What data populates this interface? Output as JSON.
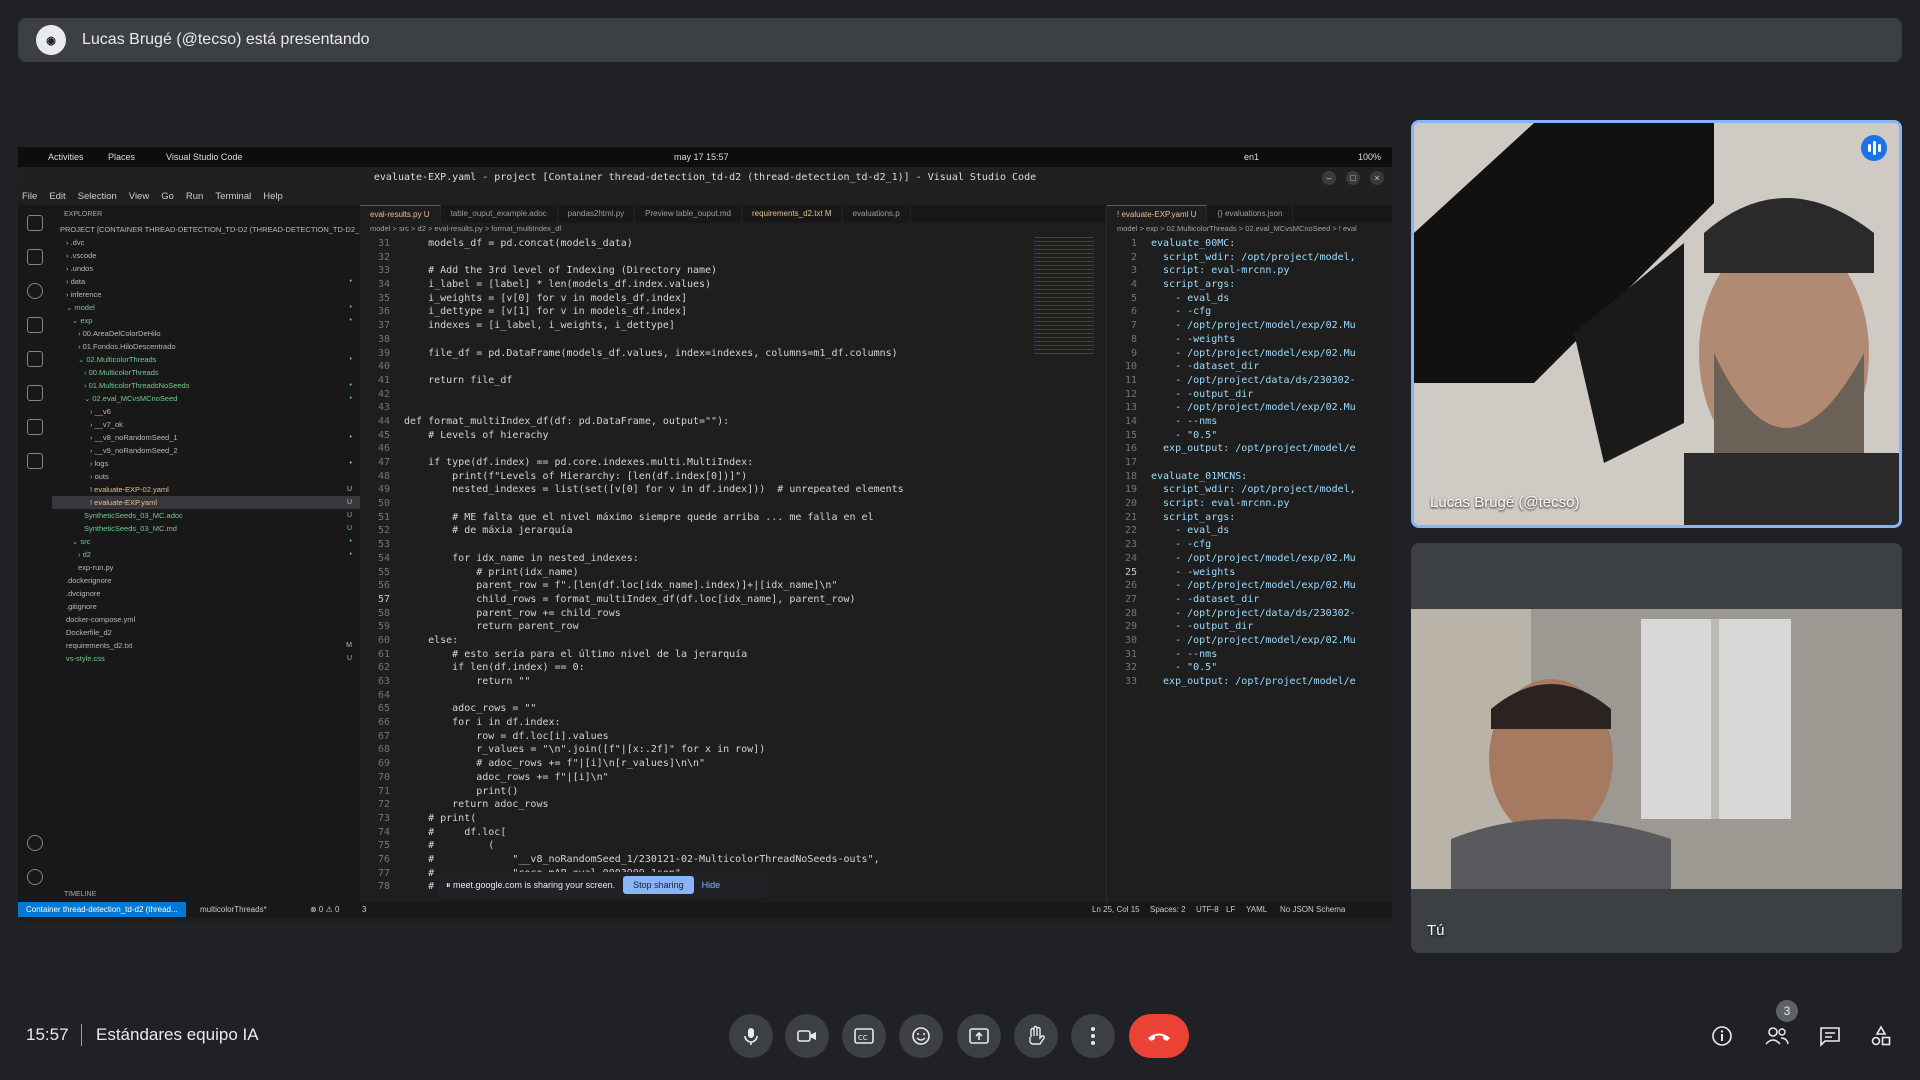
{
  "presenter_banner": {
    "text": "Lucas Brugé (@tecso) está presentando"
  },
  "shared_screen": {
    "gnome_bar": {
      "activities": "Activities",
      "places": "Places",
      "app": "Visual Studio Code",
      "clock": "may 17  15:57",
      "lang": "en1",
      "battery": "100%"
    },
    "window_title": "evaluate-EXP.yaml - project [Container thread-detection_td-d2 (thread-detection_td-d2_1)] - Visual Studio Code",
    "menu": [
      "File",
      "Edit",
      "Selection",
      "View",
      "Go",
      "Run",
      "Terminal",
      "Help"
    ],
    "explorer": {
      "header": "EXPLORER",
      "items": [
        {
          "label": "PROJECT [CONTAINER THREAD-DETECTION_TD-D2 (THREAD-DETECTION_TD-D2_1)]",
          "depth": 0,
          "color": "",
          "badge": ""
        },
        {
          "label": "› .dvc",
          "depth": 1,
          "color": "",
          "badge": ""
        },
        {
          "label": "› .vscode",
          "depth": 1,
          "color": "",
          "badge": ""
        },
        {
          "label": "› .undos",
          "depth": 1,
          "color": "",
          "badge": ""
        },
        {
          "label": "› data",
          "depth": 1,
          "color": "",
          "badge": "•"
        },
        {
          "label": "› inference",
          "depth": 1,
          "color": "",
          "badge": ""
        },
        {
          "label": "⌄ model",
          "depth": 1,
          "color": "green",
          "badge": "•"
        },
        {
          "label": "⌄ exp",
          "depth": 2,
          "color": "green",
          "badge": "•"
        },
        {
          "label": "› 00.AreaDelColorDeHilo",
          "depth": 3,
          "color": "",
          "badge": ""
        },
        {
          "label": "› 01.Fondos.HiloDescentrado",
          "depth": 3,
          "color": "",
          "badge": ""
        },
        {
          "label": "⌄ 02.MulticolorThreads",
          "depth": 3,
          "color": "green",
          "badge": "•"
        },
        {
          "label": "› 00.MulticolorThreads",
          "depth": 4,
          "color": "green",
          "badge": ""
        },
        {
          "label": "› 01.MulticolorThreadsNoSeeds",
          "depth": 4,
          "color": "green",
          "badge": "•"
        },
        {
          "label": "⌄ 02.eval_MCvsMCnoSeed",
          "depth": 4,
          "color": "green",
          "badge": "•"
        },
        {
          "label": "› __v6",
          "depth": 5,
          "color": "",
          "badge": ""
        },
        {
          "label": "› __v7_ok",
          "depth": 5,
          "color": "",
          "badge": ""
        },
        {
          "label": "› __v8_noRandomSeed_1",
          "depth": 5,
          "color": "",
          "badge": "•"
        },
        {
          "label": "› __v9_noRandomSeed_2",
          "depth": 5,
          "color": "",
          "badge": ""
        },
        {
          "label": "› logs",
          "depth": 5,
          "color": "",
          "badge": "•"
        },
        {
          "label": "› outs",
          "depth": 5,
          "color": "",
          "badge": ""
        },
        {
          "label": "! evaluate-EXP-02.yaml",
          "depth": 5,
          "color": "yellow",
          "badge": "U"
        },
        {
          "label": "! evaluate-EXP.yaml",
          "depth": 5,
          "color": "yellow",
          "badge": "U",
          "selected": true
        },
        {
          "label": "SyntheticSeeds_03_MC.adoc",
          "depth": 4,
          "color": "green",
          "badge": "U"
        },
        {
          "label": "SyntheticSeeds_03_MC.md",
          "depth": 4,
          "color": "green",
          "badge": "U"
        },
        {
          "label": "⌄ src",
          "depth": 2,
          "color": "green",
          "badge": "•"
        },
        {
          "label": "› d2",
          "depth": 3,
          "color": "green",
          "badge": "•"
        },
        {
          "label": "exp-run.py",
          "depth": 3,
          "color": "",
          "badge": ""
        },
        {
          "label": ".dockerignore",
          "depth": 1,
          "color": "",
          "badge": ""
        },
        {
          "label": ".dvcignore",
          "depth": 1,
          "color": "",
          "badge": ""
        },
        {
          "label": ".gitignore",
          "depth": 1,
          "color": "",
          "badge": ""
        },
        {
          "label": "docker-compose.yml",
          "depth": 1,
          "color": "",
          "badge": ""
        },
        {
          "label": "Dockerfile_d2",
          "depth": 1,
          "color": "",
          "badge": ""
        },
        {
          "label": "requirements_d2.txt",
          "depth": 1,
          "color": "",
          "badge": "M"
        },
        {
          "label": "vs-style.css",
          "depth": 1,
          "color": "green",
          "badge": "U"
        }
      ],
      "timeline": "TIMELINE"
    },
    "editor_left": {
      "tabs": [
        {
          "label": "eval-results.py U",
          "active": true,
          "mod": true
        },
        {
          "label": "table_ouput_example.adoc",
          "active": false,
          "mod": false
        },
        {
          "label": "pandas2html.py",
          "active": false,
          "mod": false
        },
        {
          "label": "Preview table_ouput.md",
          "active": false,
          "mod": false
        },
        {
          "label": "requirements_d2.txt M",
          "active": false,
          "mod": true
        },
        {
          "label": "evaluations.p",
          "active": false,
          "mod": false
        }
      ],
      "breadcrumb": "model > src > d2 > eval-results.py > format_multiIndex_df",
      "lines": [
        {
          "n": "31",
          "t": "    models_df = pd.concat(models_data)"
        },
        {
          "n": "32",
          "t": ""
        },
        {
          "n": "33",
          "t": "    # Add the 3rd level of Indexing (Directory name)"
        },
        {
          "n": "34",
          "t": "    i_label = [label] * len(models_df.index.values)"
        },
        {
          "n": "35",
          "t": "    i_weights = [v[0] for v in models_df.index]"
        },
        {
          "n": "36",
          "t": "    i_dettype = [v[1] for v in models_df.index]"
        },
        {
          "n": "37",
          "t": "    indexes = [i_label, i_weights, i_dettype]"
        },
        {
          "n": "38",
          "t": ""
        },
        {
          "n": "39",
          "t": "    file_df = pd.DataFrame(models_df.values, index=indexes, columns=m1_df.columns)"
        },
        {
          "n": "40",
          "t": ""
        },
        {
          "n": "41",
          "t": "    return file_df"
        },
        {
          "n": "42",
          "t": ""
        },
        {
          "n": "43",
          "t": ""
        },
        {
          "n": "44",
          "t": "def format_multiIndex_df(df: pd.DataFrame, output=\"\"):"
        },
        {
          "n": "45",
          "t": "    # Levels of hierachy"
        },
        {
          "n": "46",
          "t": ""
        },
        {
          "n": "47",
          "t": "    if type(df.index) == pd.core.indexes.multi.MultiIndex:"
        },
        {
          "n": "48",
          "t": "        print(f\"Levels of Hierarchy: [len(df.index[0])]\")"
        },
        {
          "n": "49",
          "t": "        nested_indexes = list(set([v[0] for v in df.index]))  # unrepeated elements"
        },
        {
          "n": "50",
          "t": ""
        },
        {
          "n": "51",
          "t": "        # ME falta que el nivel máximo siempre quede arriba ... me falla en el"
        },
        {
          "n": "52",
          "t": "        # de máxia jerarquía"
        },
        {
          "n": "53",
          "t": ""
        },
        {
          "n": "54",
          "t": "        for idx_name in nested_indexes:"
        },
        {
          "n": "55",
          "t": "            # print(idx_name)"
        },
        {
          "n": "56",
          "t": "            parent_row = f\".[len(df.loc[idx_name].index)]+|[idx_name]\\n\""
        },
        {
          "n": "57",
          "t": "            child_rows = format_multiIndex_df(df.loc[idx_name], parent_row)"
        },
        {
          "n": "58",
          "t": "            parent_row += child_rows"
        },
        {
          "n": "59",
          "t": "            return parent_row"
        },
        {
          "n": "60",
          "t": "    else:"
        },
        {
          "n": "61",
          "t": "        # esto sería para el último nivel de la jerarquía"
        },
        {
          "n": "62",
          "t": "        if len(df.index) == 0:"
        },
        {
          "n": "63",
          "t": "            return \"\""
        },
        {
          "n": "64",
          "t": ""
        },
        {
          "n": "65",
          "t": "        adoc_rows = \"\""
        },
        {
          "n": "66",
          "t": "        for i in df.index:"
        },
        {
          "n": "67",
          "t": "            row = df.loc[i].values"
        },
        {
          "n": "68",
          "t": "            r_values = \"\\n\".join([f\"|[x:.2f]\" for x in row])"
        },
        {
          "n": "69",
          "t": "            # adoc_rows += f\"|[i]\\n[r_values]\\n\\n\""
        },
        {
          "n": "70",
          "t": "            adoc_rows += f\"|[i]\\n\""
        },
        {
          "n": "71",
          "t": "            print()"
        },
        {
          "n": "72",
          "t": "        return adoc_rows"
        },
        {
          "n": "73",
          "t": "    # print("
        },
        {
          "n": "74",
          "t": "    #     df.loc["
        },
        {
          "n": "75",
          "t": "    #         ("
        },
        {
          "n": "76",
          "t": "    #             \"__v8_noRandomSeed_1/230121-02-MulticolorThreadNoSeeds-outs\","
        },
        {
          "n": "77",
          "t": "    #             \"coco mAP eval 0003909.1son\","
        },
        {
          "n": "78",
          "t": "    #         )"
        }
      ],
      "current_line": "57"
    },
    "editor_right": {
      "tabs": [
        {
          "label": "! evaluate-EXP.yaml U",
          "active": true,
          "mod": true
        },
        {
          "label": "{} evaluations.json",
          "active": false,
          "mod": false
        }
      ],
      "breadcrumb": "model > exp > 02.MulticolorThreads > 02.eval_MCvsMCnoSeed > ! eval",
      "lines": [
        {
          "n": "1",
          "t": "evaluate_00MC:"
        },
        {
          "n": "2",
          "t": "  script_wdir: /opt/project/model,"
        },
        {
          "n": "3",
          "t": "  script: eval-mrcnn.py"
        },
        {
          "n": "4",
          "t": "  script_args:"
        },
        {
          "n": "5",
          "t": "    - eval_ds"
        },
        {
          "n": "6",
          "t": "    - -cfg"
        },
        {
          "n": "7",
          "t": "    - /opt/project/model/exp/02.Mu"
        },
        {
          "n": "8",
          "t": "    - -weights"
        },
        {
          "n": "9",
          "t": "    - /opt/project/model/exp/02.Mu"
        },
        {
          "n": "10",
          "t": "    - -dataset_dir"
        },
        {
          "n": "11",
          "t": "    - /opt/project/data/ds/230302-"
        },
        {
          "n": "12",
          "t": "    - -output_dir"
        },
        {
          "n": "13",
          "t": "    - /opt/project/model/exp/02.Mu"
        },
        {
          "n": "14",
          "t": "    - --nms"
        },
        {
          "n": "15",
          "t": "    - \"0.5\""
        },
        {
          "n": "16",
          "t": "  exp_output: /opt/project/model/e"
        },
        {
          "n": "17",
          "t": ""
        },
        {
          "n": "18",
          "t": "evaluate_01MCNS:"
        },
        {
          "n": "19",
          "t": "  script_wdir: /opt/project/model,"
        },
        {
          "n": "20",
          "t": "  script: eval-mrcnn.py"
        },
        {
          "n": "21",
          "t": "  script_args:"
        },
        {
          "n": "22",
          "t": "    - eval_ds"
        },
        {
          "n": "23",
          "t": "    - -cfg"
        },
        {
          "n": "24",
          "t": "    - /opt/project/model/exp/02.Mu"
        },
        {
          "n": "25",
          "t": "    - -weights"
        },
        {
          "n": "26",
          "t": "    - /opt/project/model/exp/02.Mu"
        },
        {
          "n": "27",
          "t": "    - -dataset_dir"
        },
        {
          "n": "28",
          "t": "    - /opt/project/data/ds/230302-"
        },
        {
          "n": "29",
          "t": "    - -output_dir"
        },
        {
          "n": "30",
          "t": "    - /opt/project/model/exp/02.Mu"
        },
        {
          "n": "31",
          "t": "    - --nms"
        },
        {
          "n": "32",
          "t": "    - \"0.5\""
        },
        {
          "n": "33",
          "t": "  exp_output: /opt/project/model/e"
        }
      ],
      "current_line": "25"
    },
    "share_notice": {
      "text": "⏸ meet.google.com is sharing your screen.",
      "stop": "Stop sharing",
      "hide": "Hide"
    },
    "statusbar": {
      "remote": "Container thread-detection_td-d2 (thread...",
      "branch": "multicolorThreads*",
      "problems": "⊗ 0 ⚠ 0",
      "ports": "3",
      "position": "Ln 25, Col 15",
      "spaces": "Spaces: 2",
      "encoding": "UTF-8",
      "eol": "LF",
      "lang": "YAML",
      "schema": "No JSON Schema"
    }
  },
  "participants": [
    {
      "name": "Lucas Brugé (@tecso)",
      "speaking": true
    },
    {
      "name": "Tú",
      "speaking": false
    }
  ],
  "bottom_bar": {
    "time": "15:57",
    "meeting_name": "Estándares equipo IA",
    "participant_count": "3"
  },
  "icons": {
    "mic": "mic-icon",
    "camera": "camera-icon",
    "captions": "captions-icon",
    "emoji": "emoji-icon",
    "present": "present-icon",
    "hand": "raise-hand-icon",
    "more": "more-icon",
    "end": "end-call-icon",
    "info": "info-icon",
    "people": "people-icon",
    "chat": "chat-icon",
    "activities": "activities-icon"
  },
  "colors": {
    "accent": "#8ab4f8",
    "end_call": "#ea4335",
    "vscode_blue": "#0078d4",
    "speaking": "#1a73e8"
  }
}
